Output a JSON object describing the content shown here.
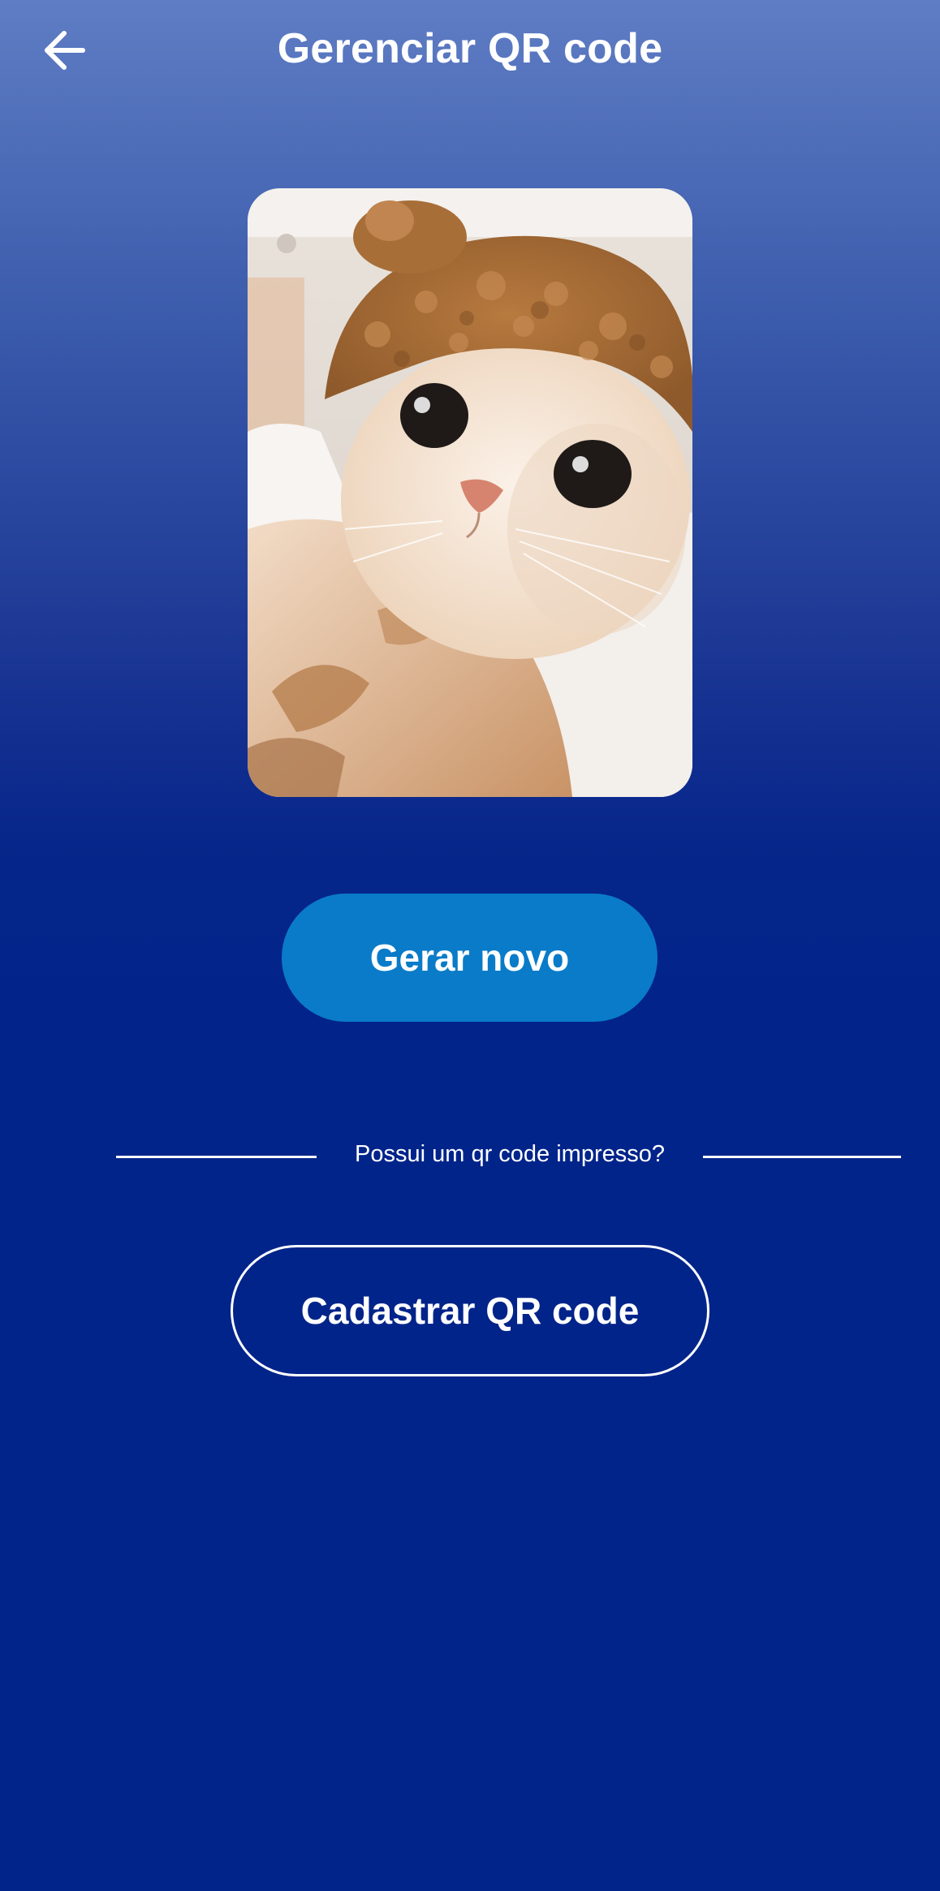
{
  "header": {
    "back_icon": "arrow-left-icon",
    "title": "Gerenciar QR code"
  },
  "photo": {
    "description_icon": "cat-photo"
  },
  "actions": {
    "generate_label": "Gerar novo",
    "divider_text": "Possui um qr code impresso?",
    "register_label": "Cadastrar QR code"
  },
  "colors": {
    "background_top": "#5f7dc4",
    "background_bottom": "#01248a",
    "primary_button": "#0a7bc8",
    "text": "#ffffff"
  }
}
